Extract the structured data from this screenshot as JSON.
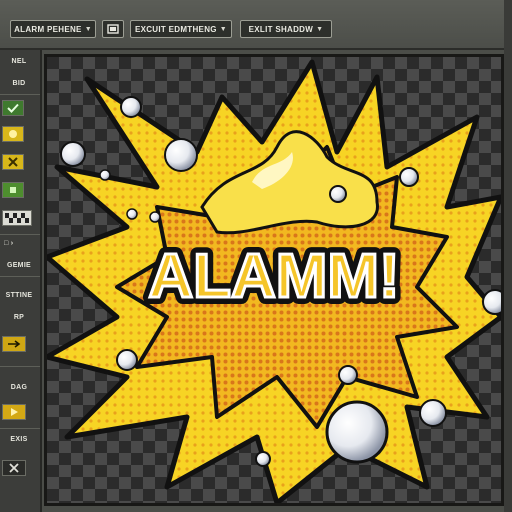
{
  "toolbar": {
    "preset_label": "ALARM PEHENE",
    "preset_value_icon": "chevron-down-icon",
    "mode_icon": "layers-icon",
    "effect_label": "EXCUIT EDMTHENG",
    "shadow_label": "EXLIT SHADDW"
  },
  "sidebar": {
    "top_label": "NEL",
    "top_label2": "BID",
    "section1_label": "GEMIE",
    "section2_label": "STTINE",
    "section2_sub": "RP",
    "section3_label": "DAG",
    "section4_label": "EXIS",
    "icons": [
      "check-icon",
      "circle-icon",
      "sparkle-icon",
      "plus-icon",
      "checker-icon",
      "arrow-right-icon",
      "play-icon",
      "close-icon"
    ]
  },
  "canvas": {
    "artwork_text": "ALAMM!",
    "colors": {
      "yellow": "#f5d21c",
      "orange": "#e8901a",
      "outline": "#111111",
      "highlight": "#fff7c2",
      "checker_dark": "#2b2b2b",
      "checker_light": "#4a4a4a"
    }
  }
}
